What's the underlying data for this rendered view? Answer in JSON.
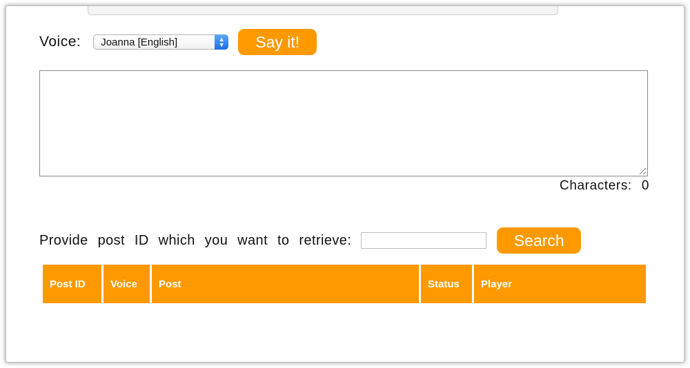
{
  "form": {
    "voice_label": "Voice:",
    "voice_selected": "Joanna [English]",
    "say_button": "Say it!",
    "text_value": "",
    "characters_label": "Characters:",
    "characters_count": "0"
  },
  "search": {
    "label": "Provide post ID which you want to retrieve:",
    "input_value": "",
    "button": "Search"
  },
  "table": {
    "headers": [
      "Post ID",
      "Voice",
      "Post",
      "Status",
      "Player"
    ]
  },
  "colors": {
    "accent": "#ff9900",
    "select_arrow": "#1d6fe0"
  },
  "icons": {
    "select_arrows": "chevron-up-down-icon",
    "resize": "resize-grip-icon"
  }
}
